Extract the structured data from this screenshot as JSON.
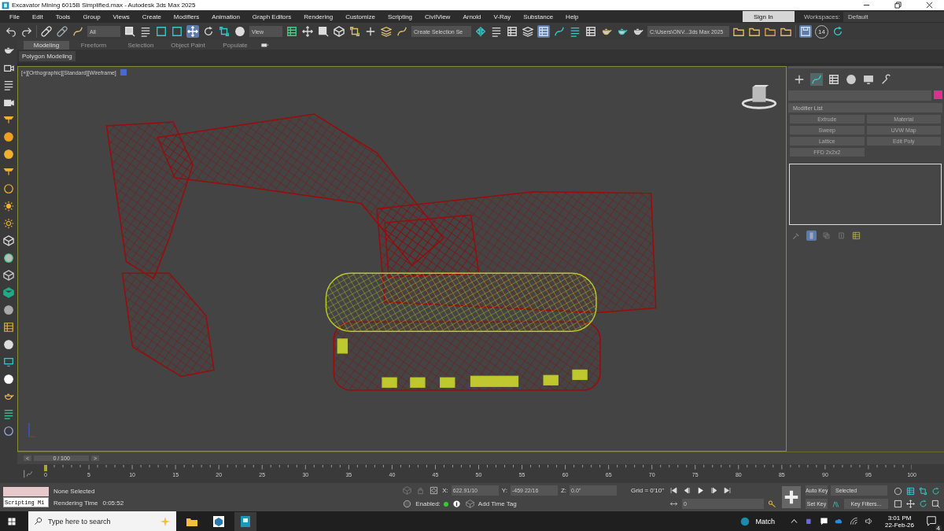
{
  "window": {
    "title": "Excavator Mining 6015B Simplified.max - Autodesk 3ds Max 2025"
  },
  "menu_bar": {
    "items": [
      "File",
      "Edit",
      "Tools",
      "Group",
      "Views",
      "Create",
      "Modifiers",
      "Animation",
      "Graph Editors",
      "Rendering",
      "Customize",
      "Scripting",
      "CivilView",
      "Arnold",
      "V-Ray",
      "Substance",
      "Help"
    ],
    "sign_in": "Sign In",
    "workspaces_label": "Workspaces:",
    "workspace": "Default"
  },
  "main_toolbar": {
    "selection_filter": "All",
    "reference_coordinate": "View",
    "named_selection": "Create Selection Se",
    "project_path": "C:\\Users\\ONV...3ds Max 2025",
    "badge": "14"
  },
  "ribbon": {
    "tabs": [
      {
        "label": "Modeling",
        "selected": true
      },
      {
        "label": "Freeform",
        "selected": false
      },
      {
        "label": "Selection",
        "selected": false
      },
      {
        "label": "Object Paint",
        "selected": false
      },
      {
        "label": "Populate",
        "selected": false
      }
    ],
    "panel": "Polygon Modeling"
  },
  "viewport": {
    "label": "[+][Orthographic][Standard][Wireframe]"
  },
  "command_panel": {
    "modifier_list": "Modifier List",
    "buttons": [
      "Extrude",
      "Material",
      "Sweep",
      "UVW Map",
      "Lattice",
      "Edit Poly",
      "FFD 2x2x2"
    ]
  },
  "time_slider": {
    "prev": "<",
    "position": "0 / 100",
    "next": ">",
    "level": 0
  },
  "track_bar": {
    "ticks": [
      "0",
      "5",
      "10",
      "15",
      "20",
      "25",
      "30",
      "35",
      "40",
      "45",
      "50",
      "55",
      "60",
      "65",
      "70",
      "75",
      "80",
      "85",
      "90",
      "95",
      "100"
    ]
  },
  "status_bar": {
    "script_field": "Scripting Mi",
    "selection": "None Selected",
    "render_label": "Rendering Time",
    "render_time": "0:05:52",
    "x_label": "X:",
    "x": "622.91/10",
    "y_label": "Y:",
    "y": "-459 22/16",
    "z_label": "Z:",
    "z": "0.0\"",
    "grid": "Grid = 0'10\"",
    "enabled": "Enabled:",
    "add_time_tag": "Add Time Tag",
    "frame": "0",
    "auto_key": "Auto Key",
    "key_mode": "Selected",
    "set_key": "Set Key",
    "key_filters": "Key Filters..."
  },
  "taskbar": {
    "search_placeholder": "Type here to search",
    "weather": "Match",
    "time": "3:01 PM",
    "date": "22-Feb-26",
    "notifications": "4"
  }
}
